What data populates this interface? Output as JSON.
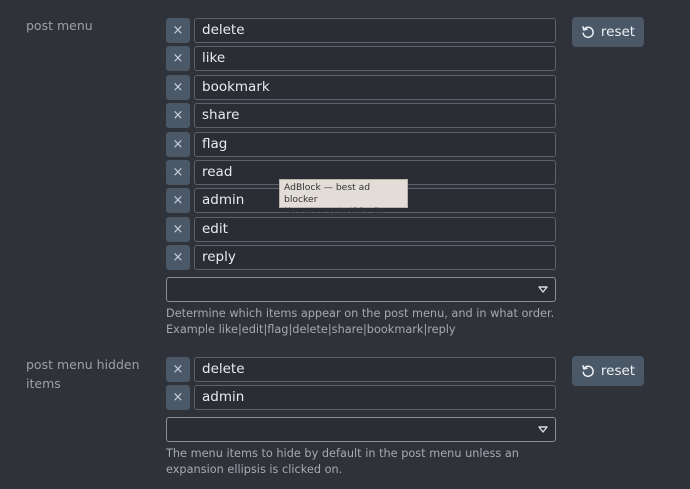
{
  "post_menu": {
    "label": "post menu",
    "items": [
      {
        "value": "delete"
      },
      {
        "value": "like"
      },
      {
        "value": "bookmark"
      },
      {
        "value": "share"
      },
      {
        "value": "flag"
      },
      {
        "value": "read"
      },
      {
        "value": "admin"
      },
      {
        "value": "edit"
      },
      {
        "value": "reply"
      }
    ],
    "select_value": "",
    "description": "Determine which items appear on the post menu, and in what order. Example like|edit|flag|delete|share|bookmark|reply",
    "reset_label": "reset",
    "remove_glyph": "×"
  },
  "post_menu_hidden_items": {
    "label": "post menu hidden items",
    "items": [
      {
        "value": "delete"
      },
      {
        "value": "admin"
      }
    ],
    "select_value": "",
    "description": "The menu items to hide by default in the post menu unless an expansion ellipsis is clicked on.",
    "reset_label": "reset",
    "remove_glyph": "×"
  },
  "tooltip": {
    "title": "AdBlock — best ad blocker",
    "subtitle": "Has access to this site"
  },
  "icons": {
    "remove": "close-icon",
    "reset": "undo-icon",
    "dropdown": "chevron-down-icon"
  },
  "colors": {
    "background": "#2f3238",
    "button": "#4a5868",
    "field_border": "#5c626b"
  }
}
